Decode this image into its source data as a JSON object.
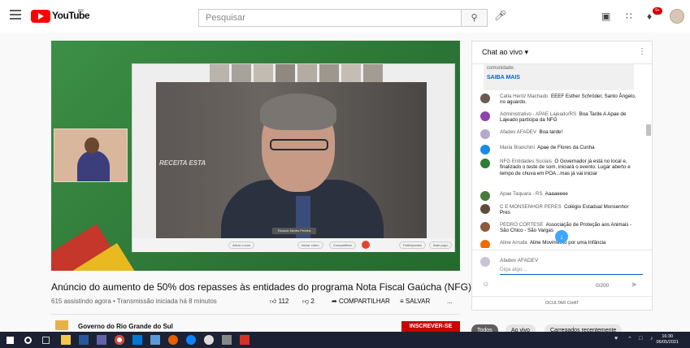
{
  "header": {
    "logo_text": "YouTube",
    "logo_region": "BR",
    "search_placeholder": "Pesquisar"
  },
  "video": {
    "meet_name_tag": "Ricardo Neves Pereira",
    "background_brand": "RECEITA ESTA",
    "meet_controls": [
      "Ativar o som",
      "Iniciar vídeo",
      "Compartilhar",
      "Participantes",
      "Bate-papo"
    ]
  },
  "title": "Anúncio do aumento de 50% dos repasses às entidades do programa Nota Fiscal Gaúcha (NFG)",
  "meta": "615 assistindo agora • Transmissão iniciada há 8 minutos",
  "actions": {
    "likes": "112",
    "dislikes": "2",
    "share": "COMPARTILHAR",
    "save": "SALVAR",
    "more": "..."
  },
  "channel": {
    "name": "Governo do Rio Grande do Sul",
    "subscribe": "INSCREVER-SE"
  },
  "chat": {
    "title": "Chat ao vivo",
    "pinned_text": "comunidade.",
    "pinned_link": "SAIBA MAIS",
    "messages": [
      {
        "author": "Catia Hentz Machado",
        "text": "EEEF Esther Schröder, Santo Ângelo, no aguardo.",
        "color": "#6b5a4e"
      },
      {
        "author": "Administrativo - APAE Lajeado/RS",
        "text": "Boa Tarde A Apae de Lajeado participa da NFG",
        "color": "#8e44ad"
      },
      {
        "author": "Afadev AFADEV",
        "text": "Boa tarde!",
        "color": "#b7a9c9"
      },
      {
        "author": "Maria Branchini",
        "text": "Apae de Flores da Cunha",
        "color": "#1e88e5"
      },
      {
        "author": "NFG Entidades Sociais",
        "text": "O Governador já está no local e, finalizado o teste de som, iniciará o evento. Lugar aberto e tempo de chuva em POA...mas já vai iniciar",
        "color": "#2e7d32"
      },
      {
        "author": "Apae Taquara - RS",
        "text": "Aaaaeeee",
        "color": "#4a7a3a"
      },
      {
        "author": "C E MONSENHOR PERES",
        "text": "Colégio Estadual Monsenhor Pres",
        "color": "#5d4b3c"
      },
      {
        "author": "PEDRO CORTESE",
        "text": "Associação de Proteção aos Animais - São Chico - São Vargas",
        "color": "#8d5a3b"
      },
      {
        "author": "Aline Arruda",
        "text": "Aline Movimento por uma Infância",
        "color": "#ef6c00"
      }
    ],
    "input_author": "Afadev AFADEV",
    "input_placeholder": "Diga algo...",
    "char_count": "0/200",
    "hide_chat": "OCULTAR CHAT"
  },
  "chips": [
    "Todos",
    "Ao vivo",
    "Carregados recentemente"
  ],
  "taskbar": {
    "time": "16:30",
    "date": "06/05/2021"
  }
}
